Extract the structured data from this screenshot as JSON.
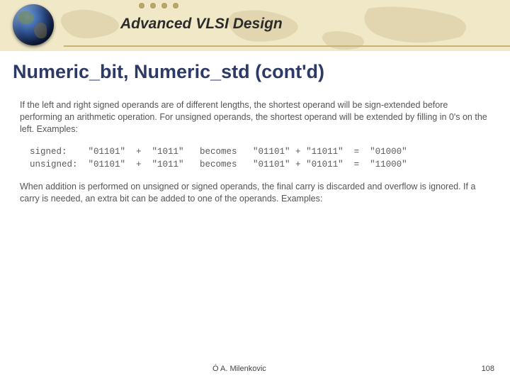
{
  "header": {
    "course_title": "Advanced VLSI Design"
  },
  "slide": {
    "title": "Numeric_bit, Numeric_std (cont'd)",
    "paragraph1": "If the left and right signed operands are of different lengths, the shortest operand will be sign-extended before performing an arithmetic operation.  For unsigned operands, the shortest operand will be extended by filling in 0's on the left.  Examples:",
    "example_block": "signed:    \"01101\"  +  \"1011\"   becomes   \"01101\" + \"11011\"  =  \"01000\"\nunsigned:  \"01101\"  +  \"1011\"   becomes   \"01101\" + \"01011\"  =  \"11000\"",
    "paragraph2": "When addition is performed on unsigned or signed operands, the final carry is discarded and overflow is ignored.  If a carry is needed, an extra bit can be added to one of the operands.  Examples:"
  },
  "footer": {
    "author": "Ó A. Milenkovic",
    "page_number": "108"
  }
}
